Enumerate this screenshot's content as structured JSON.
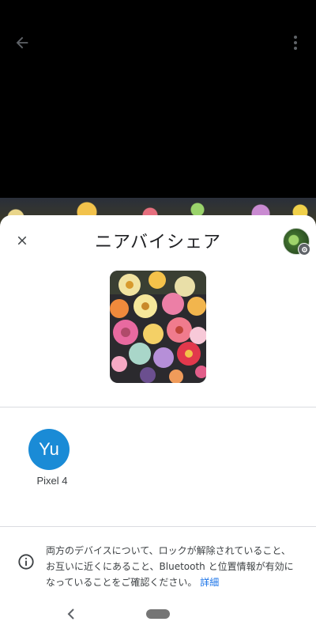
{
  "viewer": {
    "back_icon": "arrow-left-icon",
    "more_icon": "more-vert-icon"
  },
  "sheet": {
    "title": "ニアバイシェア",
    "close_icon": "close-icon",
    "account_icon": "account-avatar",
    "settings_icon": "gear-icon"
  },
  "share_item": {
    "type": "photo",
    "description_icon": "flower-bouquet-thumbnail"
  },
  "devices": [
    {
      "initials": "Yu",
      "name": "Pixel 4",
      "color": "#1a8bd6"
    }
  ],
  "info": {
    "icon": "info-icon",
    "text": "両方のデバイスについて、ロックが解除されていること、お互いに近くにあること、Bluetooth と位置情報が有効になっていることをご確認ください。",
    "link_label": "詳細",
    "link_color": "#1a73e8"
  },
  "navbar": {
    "back_icon": "nav-back-icon",
    "home_icon": "home-pill-icon"
  }
}
